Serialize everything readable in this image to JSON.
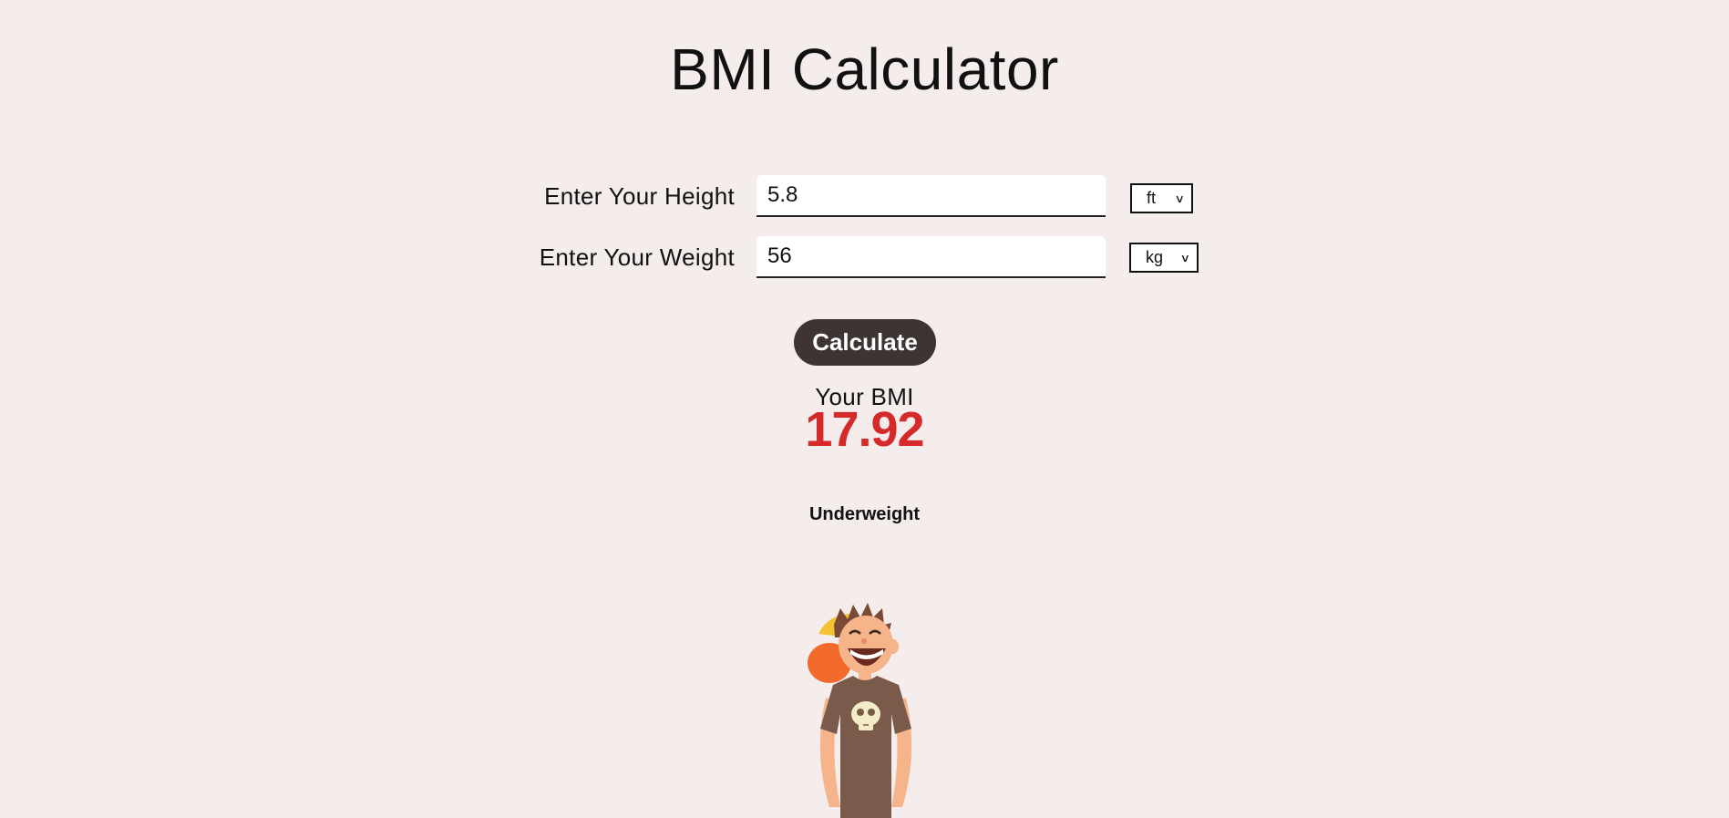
{
  "page": {
    "title": "BMI Calculator"
  },
  "form": {
    "height": {
      "label": "Enter Your Height",
      "value": "5.8",
      "unit": "ft"
    },
    "weight": {
      "label": "Enter Your Weight",
      "value": "56",
      "unit": "kg"
    },
    "calculate_label": "Calculate"
  },
  "result": {
    "label": "Your BMI",
    "value": "17.92",
    "category": "Underweight"
  },
  "colors": {
    "background": "#f5ecec",
    "bmi_value": "#d42a2a",
    "button": "#3d3433"
  },
  "illustration": {
    "icon": "underweight-person-illustration"
  }
}
